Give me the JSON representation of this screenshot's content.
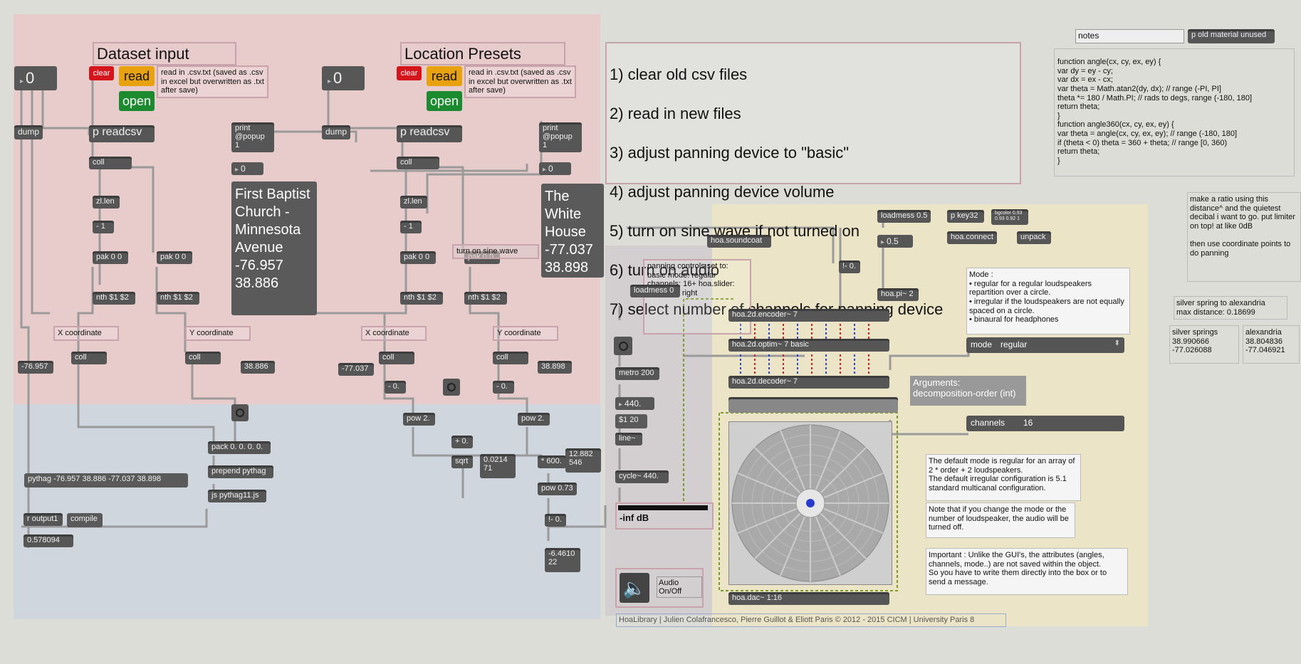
{
  "colors": {
    "background": "#dcddd7",
    "dataset_region": "#e8cccc",
    "bottom_region": "#cfd6de",
    "hoa_region": "#ece4c6",
    "object_bg": "#565656",
    "clear_red": "#d4151c",
    "read_orange": "#e8a10f",
    "open_green": "#1c8a2f"
  },
  "left": {
    "title": "Dataset input",
    "num_top": "0",
    "clear": "clear",
    "read": "read",
    "open": "open",
    "read_comment": "read in .csv.txt (saved as .csv in excel but overwritten as .txt after save)",
    "dump": "dump",
    "readcsv": "p readcsv",
    "coll": "coll",
    "print": "print @popup 1",
    "print_num": "0",
    "place_name": "First Baptist Church - Minnesota Avenue -76.957 38.886",
    "zllen": "zl.len",
    "minus1": "- 1",
    "pak1": "pak 0 0",
    "pak2": "pak 0 0",
    "nth1": "nth $1 $2",
    "nth2": "nth $1 $2",
    "xcoord": "X coordinate",
    "ycoord": "Y coordinate",
    "collx": "coll",
    "colly": "coll",
    "xval": "-76.957",
    "yval": "38.886"
  },
  "right_ds": {
    "title": "Location Presets",
    "num_top": "0",
    "clear": "clear",
    "read": "read",
    "open": "open",
    "read_comment": "read in .csv.txt (saved as .csv in excel but overwritten as .txt after save)",
    "dump": "dump",
    "readcsv": "p readcsv",
    "coll": "coll",
    "print": "print @popup 1",
    "print_num": "0",
    "place_name": "The White House -77.037 38.898",
    "zllen": "zl.len",
    "minus1": "- 1",
    "pak1": "pak 0 0",
    "pak2": "pak 0 0",
    "nth1": "nth $1 $2",
    "nth2": "nth $1 $2",
    "xcoord": "X coordinate",
    "ycoord": "Y coordinate",
    "collx": "coll",
    "colly": "coll",
    "xval": "-77.037",
    "yval": "38.898"
  },
  "math": {
    "minus0a": "- 0.",
    "minus0b": "- 0.",
    "pow2a": "pow 2.",
    "pow2b": "pow 2.",
    "plus0": "+ 0.",
    "sqrt": "sqrt",
    "sqrt_val": "0.0214 71",
    "mul600": "* 600.",
    "mul_val": "12.882 546",
    "pow073": "pow 0.73",
    "inv0": "!- 0.",
    "final_val": "-6.4610 22",
    "pack": "pack 0. 0. 0. 0.",
    "prepend": "prepend pythag",
    "js": "js pythag11.js",
    "pythag_msg": "pythag -76.957 38.886 -77.037 38.898",
    "routput": "r output1",
    "compile": "compile",
    "result": "0.578094",
    "sine_comment": "turn on sine wave"
  },
  "steps": [
    "1) clear old csv files",
    "2) read in new files",
    "3) adjust panning device to \"basic\"",
    "4) adjust panning device volume",
    "5) turn on sine wave if not turned on",
    "6) turn on audio",
    "7) select number of channels for panning device"
  ],
  "notes": {
    "notes_label": "notes",
    "old_material": "p old material unused",
    "code": "function angle(cx, cy, ex, ey) {\n  var dy = ey - cy;\n  var dx = ex - cx;\n  var theta = Math.atan2(dy, dx); // range (-PI, PI]\n  theta *= 180 / Math.PI; // rads to degs, range (-180, 180]\n  return theta;\n}\nfunction angle360(cx, cy, ex, ey) {\n  var theta = angle(cx, cy, ex, ey); // range (-180, 180]\n  if (theta < 0) theta = 360 + theta; // range [0, 360)\n  return theta;\n}",
    "ratio_comment": "make a ratio using this distance^ and the quietest decibal i want to go. put limiter on top! at like 0dB\n\nthen use coordinate points to do panning",
    "silver_alex": "silver spring to alexandria\nmax distance: 0.18699",
    "silver": "silver springs\n38.990666\n-77.026088",
    "alex": "alexandria\n38.804836\n-77.046921"
  },
  "hoa": {
    "soundcoat": "hoa.soundcoat",
    "loadmess05": "loadmess 0.5",
    "pkey32": "p key32",
    "bgcolor": "bgcolor 0.93 0.93 0.92 1",
    "num05": "0.5",
    "connect": "hoa.connect",
    "unpack": "unpack",
    "inv0": "!- 0.",
    "pi2": "hoa.pi~ 2",
    "panning_comment": "panning controls set to: basic mode: regular channels: 16+ hoa.slider: 4/5 to the right",
    "loadmess0": "loadmess 0",
    "metro": "metro 200",
    "num440": "440.",
    "msg120": "$1 20",
    "line": "line~",
    "cycle": "cycle~ 440.",
    "gain": "-inf dB",
    "audio": "Audio On/Off",
    "encoder": "hoa.2d.encoder~ 7",
    "optim": "hoa.2d.optim~ 7 basic",
    "decoder": "hoa.2d.decoder~ 7",
    "arguments": "Arguments:\ndecomposition-order (int)",
    "mode_comment": "Mode :\n• regular for a regular loudspeakers repartition over a circle.\n• irregular if the loudspeakers are not equally spaced on a circle.\n• binaural for headphones",
    "mode_label": "mode",
    "mode_value": "regular",
    "channels_label": "channels",
    "channels_value": "16",
    "default_comment": "The default mode is regular for an array of  2 * order + 2 loudspeakers.\nThe default irregular configuration is 5.1 standard multicanal configuration.",
    "note_comment": "Note that if you change the mode or the number of loudspeaker, the audio will be turned off.",
    "important_comment": "Important : Unlike the GUI's, the attributes (angles, channels, mode..) are not saved within the object.\nSo you have to write them directly into the box or to send a message.",
    "dac": "hoa.dac~ 1:16",
    "credits": "HoaLibrary | Julien Colafrancesco, Pierre Guillot & Eliott Paris © 2012 - 2015 CICM | University Paris 8"
  }
}
